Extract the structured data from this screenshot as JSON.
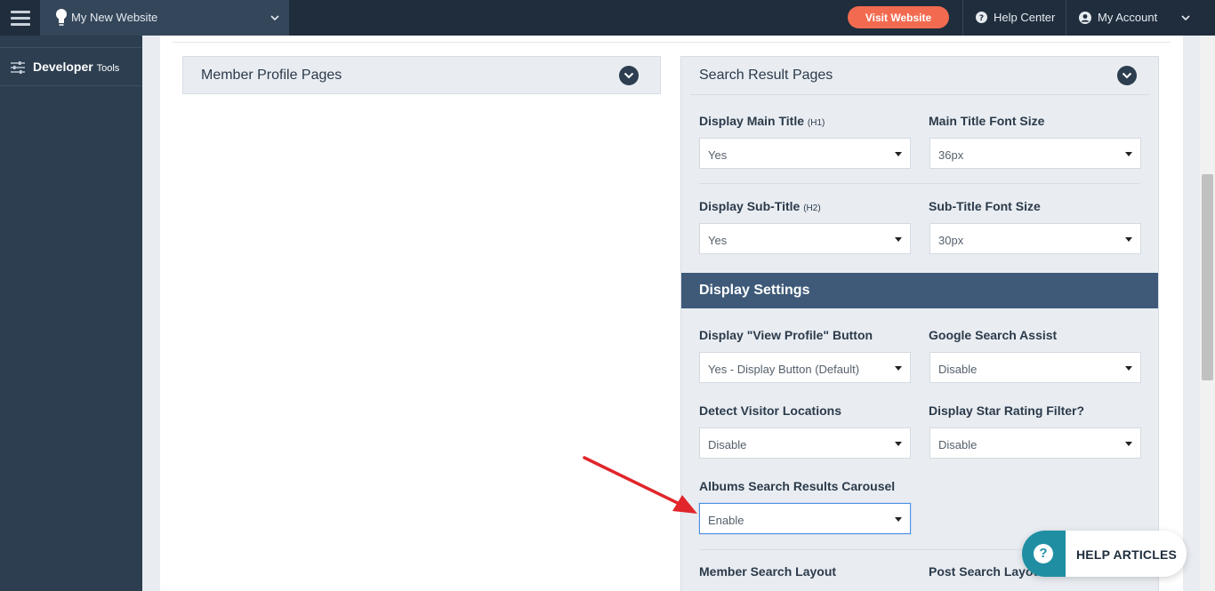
{
  "topbar": {
    "site_name": "My New Website",
    "visit_button": "Visit Website",
    "help_center": "Help Center",
    "my_account": "My Account"
  },
  "sidebar": {
    "developer_tools_label": "Developer",
    "developer_tools_suffix": "Tools"
  },
  "panels": {
    "member_profile": {
      "title": "Member Profile Pages"
    },
    "search_result": {
      "title": "Search Result Pages",
      "fields": {
        "display_main_title": {
          "label": "Display Main Title",
          "tag": "(H1)",
          "value": "Yes"
        },
        "main_title_font_size": {
          "label": "Main Title Font Size",
          "value": "36px"
        },
        "display_sub_title": {
          "label": "Display Sub-Title",
          "tag": "(H2)",
          "value": "Yes"
        },
        "sub_title_font_size": {
          "label": "Sub-Title Font Size",
          "value": "30px"
        }
      }
    },
    "display_settings": {
      "title": "Display Settings",
      "fields": {
        "view_profile_button": {
          "label": "Display \"View Profile\" Button",
          "value": "Yes - Display Button (Default)"
        },
        "google_search_assist": {
          "label": "Google Search Assist",
          "value": "Disable"
        },
        "detect_visitor_locations": {
          "label": "Detect Visitor Locations",
          "value": "Disable"
        },
        "star_rating_filter": {
          "label": "Display Star Rating Filter?",
          "value": "Disable"
        },
        "albums_carousel": {
          "label": "Albums Search Results Carousel",
          "value": "Enable"
        },
        "member_search_layout": {
          "label": "Member Search Layout"
        },
        "post_search_layout": {
          "label": "Post Search Layout"
        }
      }
    }
  },
  "help_widget": {
    "label": "HELP ARTICLES",
    "icon": "question-icon"
  },
  "colors": {
    "topbar": "#1f2d3d",
    "accent_button": "#f26b50",
    "section_header": "#3e5a78",
    "help_teal": "#1f8ea3",
    "annotation_arrow": "#e0262b"
  }
}
